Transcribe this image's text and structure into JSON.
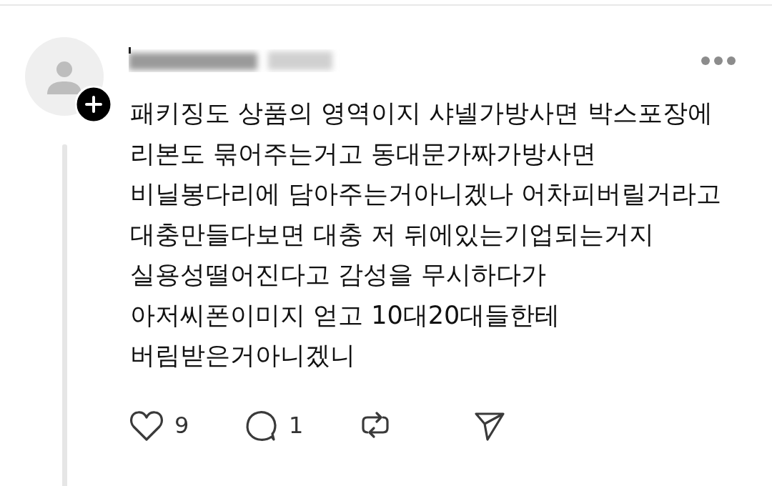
{
  "comment": {
    "text": "패키징도 상품의 영역이지 샤넬가방사면 박스포장에\n리본도 묶어주는거고 동대문가짜가방사면\n비닐봉다리에 담아주는거아니겠나 어차피버릴거라고\n대충만들다보면 대충 저 뒤에있는기업되는거지\n실용성떨어진다고 감성을 무시하다가\n아저씨폰이미지 얻고 10대20대들한테\n버림받은거아니겠니",
    "actions": [
      {
        "kind": "like",
        "count": "9"
      },
      {
        "kind": "reply",
        "count": "1"
      },
      {
        "kind": "repost"
      },
      {
        "kind": "share"
      }
    ]
  }
}
